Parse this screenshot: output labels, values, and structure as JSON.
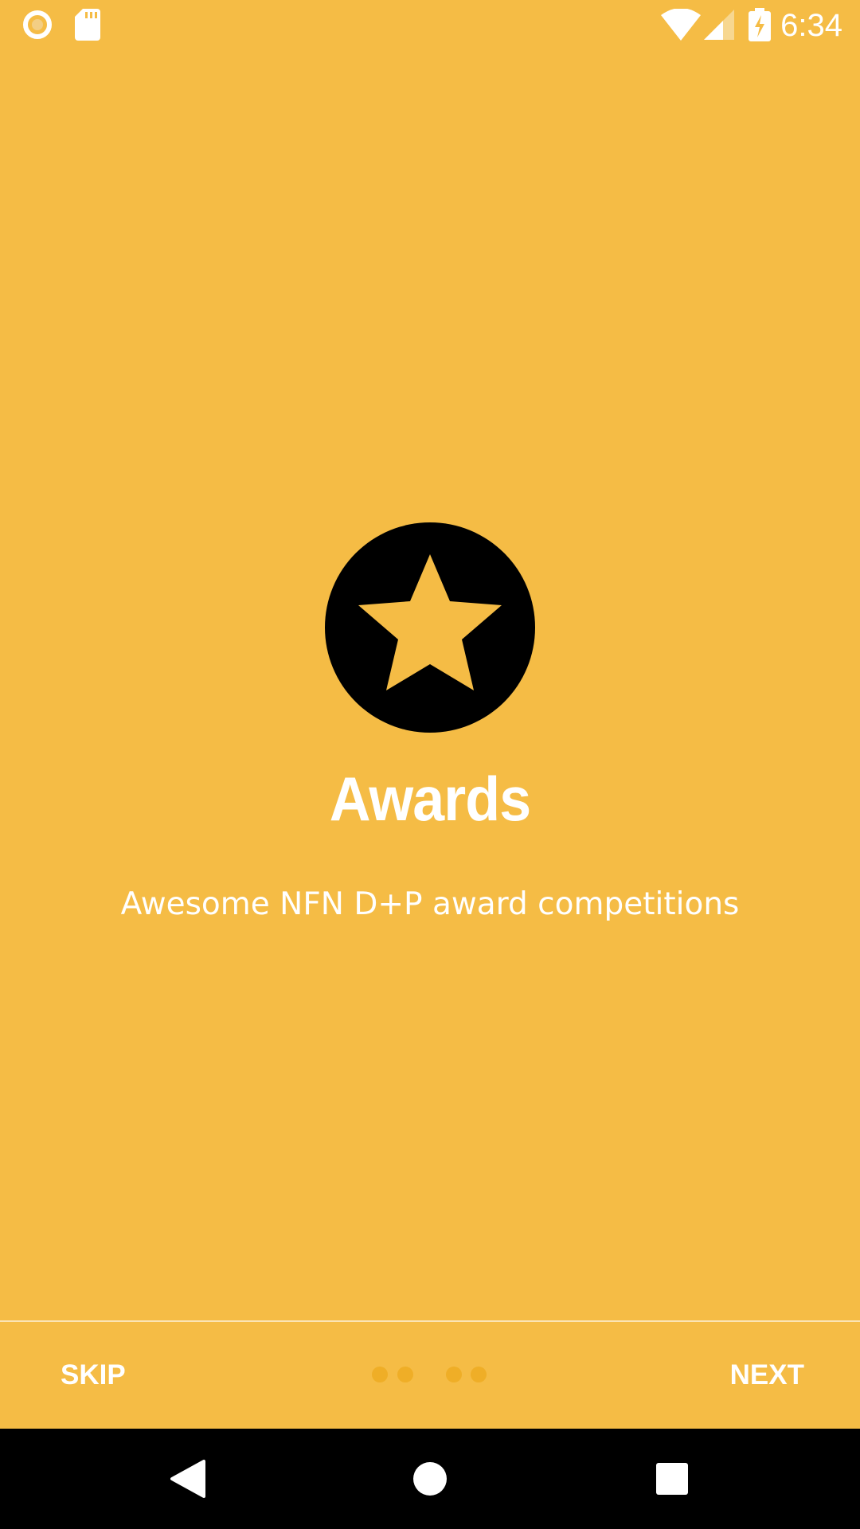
{
  "status_bar": {
    "time": "6:34",
    "icons": [
      "record-icon",
      "sd-card-icon",
      "wifi-icon",
      "cell-signal-icon",
      "battery-charging-icon"
    ]
  },
  "slide": {
    "icon": "star-badge-icon",
    "title": "Awards",
    "description": "Awesome NFN D+P award competitions"
  },
  "pager": {
    "skip_label": "SKIP",
    "next_label": "NEXT",
    "page_count": 4,
    "current_page": 3
  },
  "nav_bar": {
    "buttons": [
      "back-icon",
      "home-icon",
      "recents-icon"
    ]
  },
  "colors": {
    "background": "#F5BC45",
    "text": "#FFFFFF",
    "icon_fill": "#000000",
    "dot_inactive": "#EFAE27"
  }
}
